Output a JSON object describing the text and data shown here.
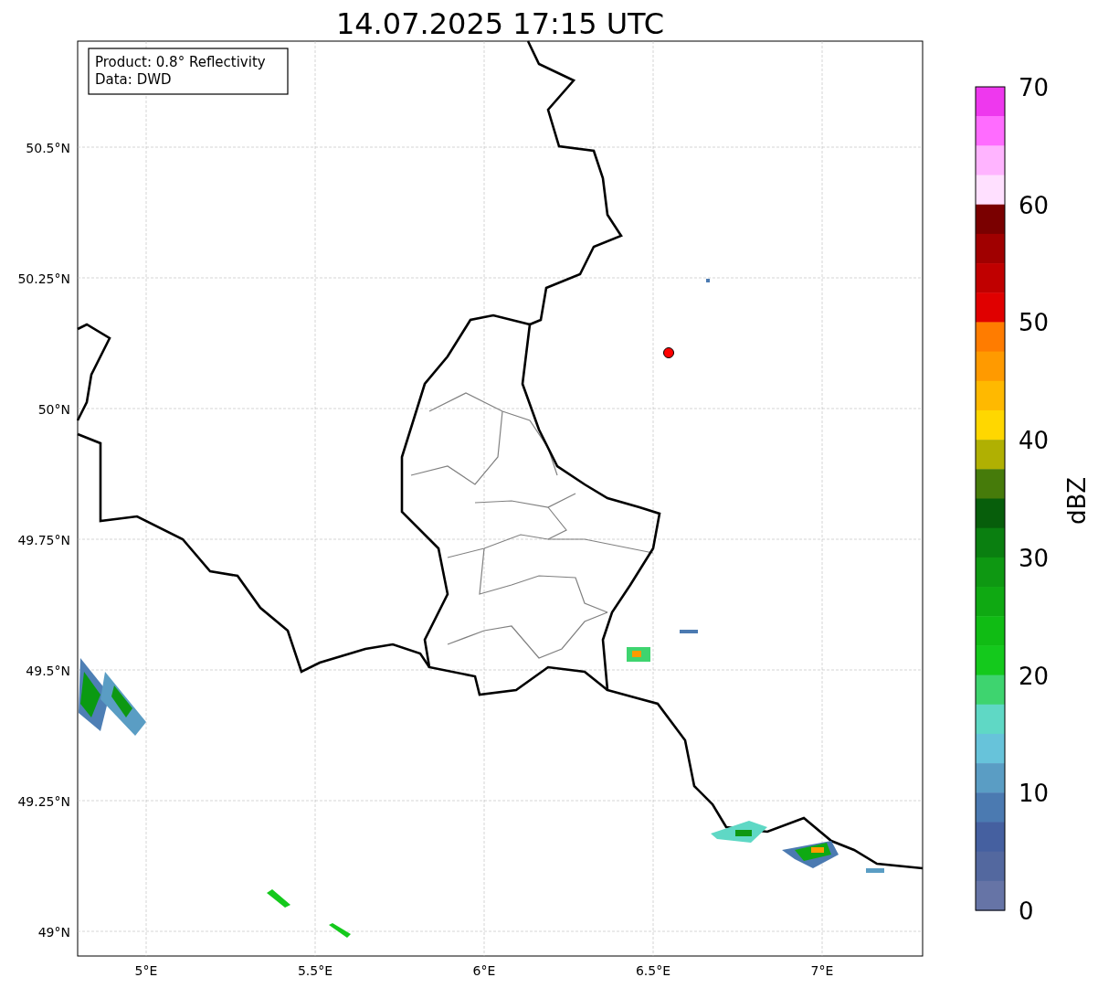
{
  "title": "14.07.2025 17:15 UTC",
  "info_box": {
    "lines": [
      "Product: 0.8° Reflectivity",
      "Data: DWD"
    ]
  },
  "map": {
    "yticks": [
      "50.5°N",
      "50.25°N",
      "50°N",
      "49.75°N",
      "49.5°N",
      "49.25°N",
      "49°N"
    ],
    "xticks": [
      "5°E",
      "5.5°E",
      "6°E",
      "6.5°E",
      "7°E"
    ]
  },
  "colorbar": {
    "label": "dBZ",
    "ticks": [
      "70",
      "60",
      "50",
      "40",
      "30",
      "20",
      "10",
      "0"
    ],
    "bands": [
      {
        "color": "#ee38ee"
      },
      {
        "color": "#ff6cff"
      },
      {
        "color": "#ffb4ff"
      },
      {
        "color": "#ffe0ff"
      },
      {
        "color": "#7a0000"
      },
      {
        "color": "#a00000"
      },
      {
        "color": "#c00000"
      },
      {
        "color": "#e00000"
      },
      {
        "color": "#ff7c00"
      },
      {
        "color": "#ff9a00"
      },
      {
        "color": "#ffb900"
      },
      {
        "color": "#ffd700"
      },
      {
        "color": "#b0b002"
      },
      {
        "color": "#467b0a"
      },
      {
        "color": "#075e0b"
      },
      {
        "color": "#0a7f10"
      },
      {
        "color": "#0e9812"
      },
      {
        "color": "#0fa912"
      },
      {
        "color": "#10bc14"
      },
      {
        "color": "#14c91c"
      },
      {
        "color": "#3ed46f"
      },
      {
        "color": "#5fd8c5"
      },
      {
        "color": "#67c3da"
      },
      {
        "color": "#5a9dc4"
      },
      {
        "color": "#4b7ab1"
      },
      {
        "color": "#4560a0"
      },
      {
        "color": "#53689f"
      },
      {
        "color": "#6674a6"
      }
    ]
  }
}
